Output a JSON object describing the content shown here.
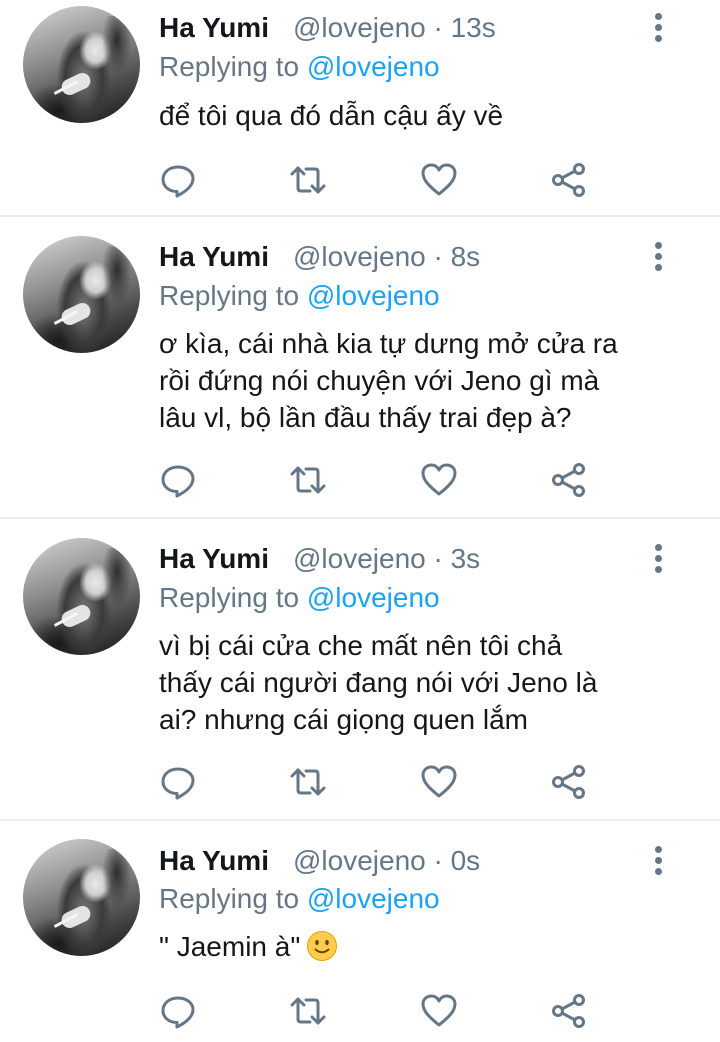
{
  "tweets": [
    {
      "name": "Ha Yumi",
      "handle": "@lovejeno · 13s",
      "replying_prefix": "Replying to ",
      "replying_to": "@lovejeno",
      "lines": [
        "để tôi qua đó dẫn cậu ấy về"
      ]
    },
    {
      "name": "Ha Yumi",
      "handle": "@lovejeno · 8s",
      "replying_prefix": "Replying to ",
      "replying_to": "@lovejeno",
      "lines": [
        "ơ kìa, cái nhà kia tự dưng mở cửa ra",
        "rồi đứng nói chuyện với Jeno gì mà",
        "lâu vl, bộ lần đầu thấy trai đẹp à?"
      ]
    },
    {
      "name": "Ha Yumi",
      "handle": "@lovejeno · 3s",
      "replying_prefix": "Replying to ",
      "replying_to": "@lovejeno",
      "lines": [
        "vì bị cái cửa che mất nên tôi chả",
        "thấy cái người đang nói với Jeno là",
        "ai? nhưng cái giọng quen lắm"
      ]
    },
    {
      "name": "Ha Yumi",
      "handle": "@lovejeno · 0s",
      "replying_prefix": "Replying to ",
      "replying_to": "@lovejeno",
      "lines": [
        "\" Jaemin à\""
      ],
      "emoji": "slightly-smiling-face"
    }
  ],
  "icons": {
    "reply": "reply-icon",
    "retweet": "retweet-icon",
    "like": "heart-icon",
    "share": "share-icon",
    "more": "more-vertical-icon"
  },
  "colors": {
    "name": "#14171a",
    "muted": "#657786",
    "mention": "#1da1f2",
    "divider": "#e6ecf0"
  }
}
